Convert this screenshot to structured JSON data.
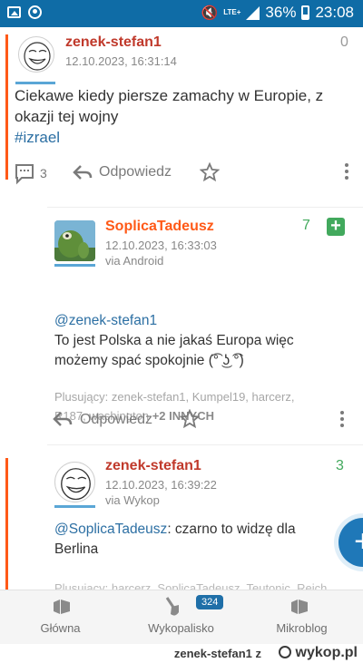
{
  "status_bar": {
    "network": "LTE+",
    "battery": "36%",
    "time": "23:08"
  },
  "posts": {
    "main": {
      "author": "zenek-stefan1",
      "date": "12.10.2023, 16:31:14",
      "votes": "0",
      "text_line1": "Ciekawe kiedy piersze zamachy w Europie, z",
      "text_line2": "okazji tej wojny",
      "tag": "#izrael",
      "comments_count": "3",
      "reply_label": "Odpowiedz"
    },
    "comment1": {
      "author": "SoplicaTadeusz",
      "date": "12.10.2023, 16:33:03",
      "via": "via Android",
      "votes": "7",
      "mention": "@zenek-stefan1",
      "text_line1": "To jest Polska a nie jakaś Europa więc",
      "text_line2": "możemy spać spokojnie (͡° ͜ʖ ͡°)",
      "plusers_label": "Plusujący:",
      "plusers_line1": "zenek-stefan1, Kumpel19, harcerz,",
      "plusers_line2": "R187, washington",
      "plusers_more": "+2 INNYCH",
      "reply_label": "Odpowiedz"
    },
    "comment2": {
      "author": "zenek-stefan1",
      "date": "12.10.2023, 16:39:22",
      "via": "via Wykop",
      "votes": "3",
      "mention": "@SoplicaTadeusz",
      "text_rest": ": czarno to widzę dla",
      "text_line2": "Berlina",
      "plusers_partial": "Plusujący: harcerz, SoplicaTadeusz, Teutonic, Reich"
    }
  },
  "fab_icon": "plus-icon",
  "bottom_nav": {
    "items": [
      {
        "label": "Główna",
        "icon": "home-icon"
      },
      {
        "label": "Wykopalisko",
        "icon": "shovel-icon",
        "badge": "324"
      },
      {
        "label": "Mikroblog",
        "icon": "mikroblog-icon"
      }
    ]
  },
  "watermark": {
    "user": "zenek-stefan1",
    "separator": "z",
    "site": "wykop.pl"
  },
  "colors": {
    "status_bar": "#0f6ca6",
    "author_orange": "#ff5917",
    "author_red": "#c0392b",
    "link_blue": "#2c6fa3",
    "votes_green": "#42a95d",
    "fab_blue": "#1f78b8"
  }
}
